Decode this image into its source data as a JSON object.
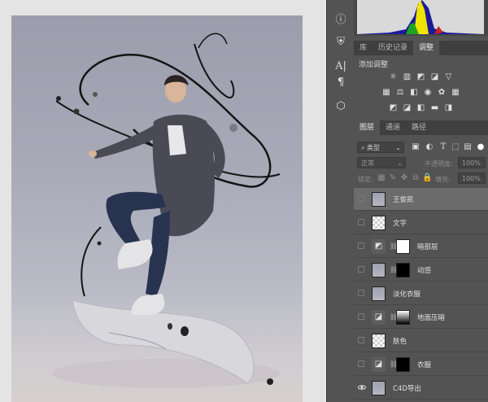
{
  "right_strip": {
    "icons": [
      "info-icon",
      "person-stamp-icon",
      "character-icon",
      "paragraph-icon",
      "cube-icon"
    ]
  },
  "top_tabs": [
    {
      "label": "库",
      "active": false
    },
    {
      "label": "历史记录",
      "active": false
    },
    {
      "label": "调整",
      "active": true
    }
  ],
  "adjustments": {
    "title": "添加调整"
  },
  "layer_tabs": [
    {
      "label": "图层",
      "active": true
    },
    {
      "label": "通道",
      "active": false
    },
    {
      "label": "路径",
      "active": false
    }
  ],
  "layer_controls": {
    "filter_kind": "类型",
    "blend_mode": "正常",
    "opacity_label": "不透明度:",
    "opacity_value": "100%",
    "lock_label": "锁定:",
    "fill_label": "填充:",
    "fill_value": "100%"
  },
  "layers": [
    {
      "name": "王俊凯",
      "visible": false,
      "selected": true,
      "thumb": "photo",
      "mask": null
    },
    {
      "name": "文字",
      "visible": false,
      "selected": false,
      "thumb": "check",
      "mask": null
    },
    {
      "name": "暗部层",
      "visible": false,
      "selected": false,
      "thumb": "adj",
      "mask": "white"
    },
    {
      "name": "动感",
      "visible": false,
      "selected": false,
      "thumb": "photo",
      "mask": "black"
    },
    {
      "name": "淡化衣服",
      "visible": false,
      "selected": false,
      "thumb": "photo",
      "mask": null
    },
    {
      "name": "地面压暗",
      "visible": false,
      "selected": false,
      "thumb": "adj",
      "mask": "gradient"
    },
    {
      "name": "肤色",
      "visible": false,
      "selected": false,
      "thumb": "check",
      "mask": null
    },
    {
      "name": "衣服",
      "visible": false,
      "selected": false,
      "thumb": "adj",
      "mask": "black"
    },
    {
      "name": "C4D导出",
      "visible": true,
      "selected": false,
      "thumb": "photo",
      "mask": null
    }
  ],
  "colors": {
    "panel_bg": "#535353",
    "selected_row": "#6b6b6b",
    "canvas_bg": "#a9aab8"
  }
}
